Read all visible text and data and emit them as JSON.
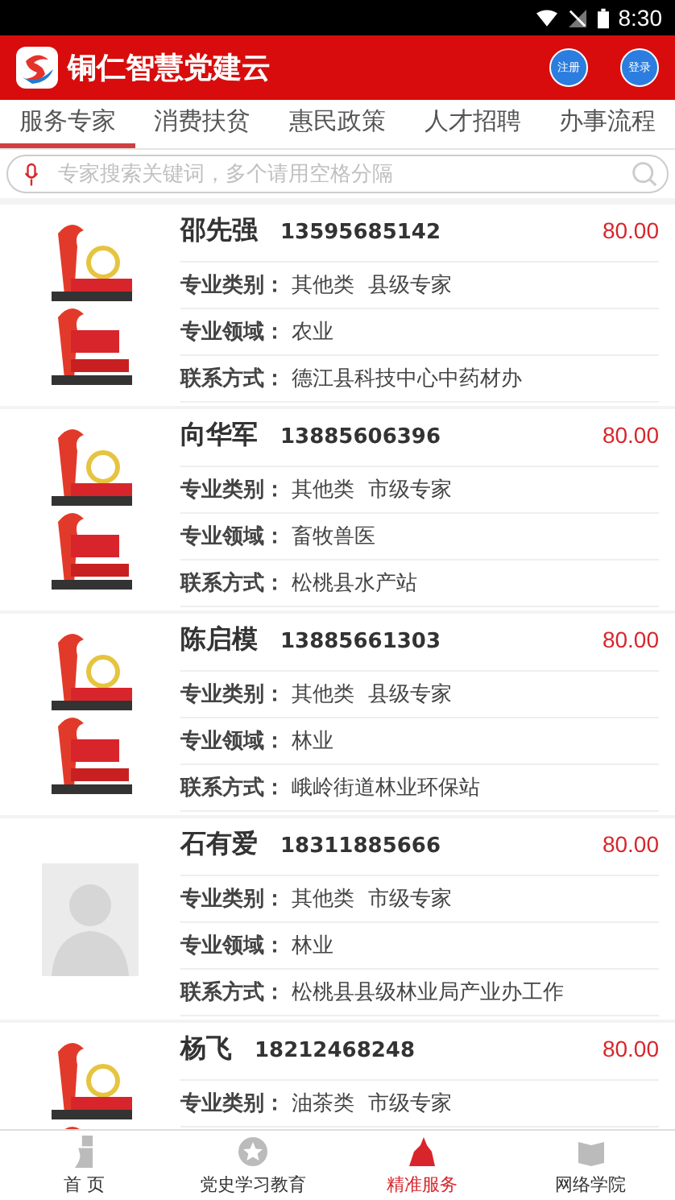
{
  "status_bar": {
    "time": "8:30"
  },
  "header": {
    "title": "铜仁智慧党建云",
    "buttons": [
      "注册",
      "登录"
    ]
  },
  "tabs": [
    {
      "label": "服务专家",
      "selected": true
    },
    {
      "label": "消费扶贫",
      "selected": false
    },
    {
      "label": "惠民政策",
      "selected": false
    },
    {
      "label": "人才招聘",
      "selected": false
    },
    {
      "label": "办事流程",
      "selected": false
    }
  ],
  "search": {
    "placeholder": "专家搜索关键词，多个请用空格分隔"
  },
  "experts": [
    {
      "kind": "picture",
      "name": "邵先强",
      "phone": "13595685142",
      "price": "80.00",
      "fields": [
        {
          "label": "专业类别：",
          "value": "其他类  县级专家"
        },
        {
          "label": "专业领域：",
          "value": "农业"
        },
        {
          "label": "联系方式：",
          "value": "德江县科技中心中药材办"
        }
      ]
    },
    {
      "kind": "picture",
      "name": "向华军",
      "phone": "13885606396",
      "price": "80.00",
      "fields": [
        {
          "label": "专业类别：",
          "value": "其他类  市级专家"
        },
        {
          "label": "专业领域：",
          "value": "畜牧兽医"
        },
        {
          "label": "联系方式：",
          "value": "松桃县水产站"
        }
      ]
    },
    {
      "kind": "picture",
      "name": "陈启模",
      "phone": "13885661303",
      "price": "80.00",
      "fields": [
        {
          "label": "专业类别：",
          "value": "其他类  县级专家"
        },
        {
          "label": "专业领域：",
          "value": "林业"
        },
        {
          "label": "联系方式：",
          "value": "峨岭街道林业环保站"
        }
      ]
    },
    {
      "kind": "avatar",
      "name": "石有爱",
      "phone": "18311885666",
      "price": "80.00",
      "fields": [
        {
          "label": "专业类别：",
          "value": "其他类  市级专家"
        },
        {
          "label": "专业领域：",
          "value": "林业"
        },
        {
          "label": "联系方式：",
          "value": "松桃县县级林业局产业办工作"
        }
      ]
    },
    {
      "kind": "picture",
      "name": "杨飞",
      "phone": "18212468248",
      "price": "80.00",
      "fields": [
        {
          "label": "专业类别：",
          "value": "油茶类  市级专家"
        }
      ]
    }
  ],
  "bottom_nav": [
    {
      "label": "首 页",
      "selected": false
    },
    {
      "label": "党史学习教育",
      "selected": false
    },
    {
      "label": "精准服务",
      "selected": true
    },
    {
      "label": "网络学院",
      "selected": false
    }
  ]
}
